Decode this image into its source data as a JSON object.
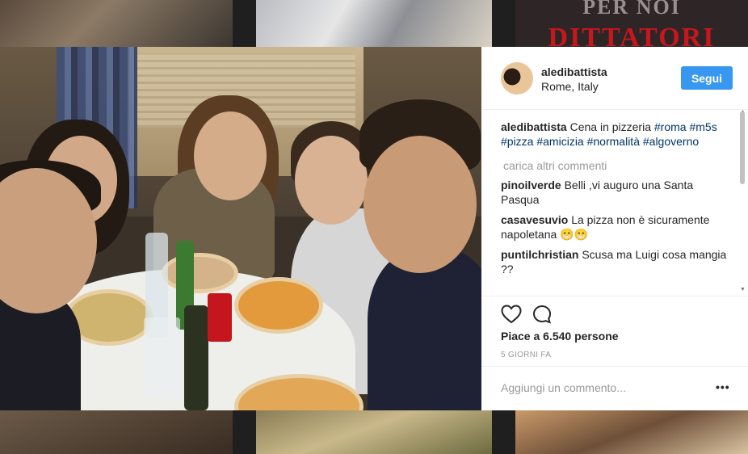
{
  "background": {
    "tile_top_right_line1": "PER NOI",
    "tile_top_right_line2": "DITTATORI"
  },
  "post": {
    "username": "aledibattista",
    "location": "Rome, Italy",
    "follow_label": "Segui",
    "caption": {
      "user": "aledibattista",
      "text": "Cena in pizzeria",
      "hashtags": [
        "#roma",
        "#m5s",
        "#pizza",
        "#amicizia",
        "#normalità",
        "#algoverno"
      ]
    },
    "load_more_label": "carica altri commenti",
    "comments": [
      {
        "user": "pinoilverde",
        "text": "Belli ,vi auguro una Santa Pasqua"
      },
      {
        "user": "casavesuvio",
        "text": "La pizza non è sicuramente napoletana 😁😁"
      },
      {
        "user": "puntilchristian",
        "text": "Scusa ma Luigi cosa mangia ??"
      }
    ],
    "likes_text": "Piace a 6.540 persone",
    "time_text": "5 GIORNI FA",
    "comment_placeholder": "Aggiungi un commento...",
    "more_label": "•••"
  },
  "icons": {
    "like": "heart-icon",
    "comment": "comment-bubble-icon"
  },
  "colors": {
    "follow_button": "#3897f0",
    "hashtag": "#003569",
    "muted": "#999999"
  }
}
